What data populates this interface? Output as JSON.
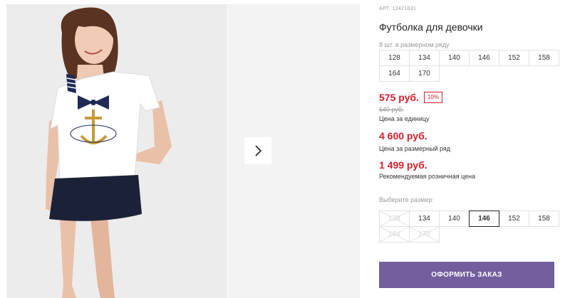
{
  "product": {
    "article_label": "АРТ.",
    "article_number": "12421631",
    "title": "Футболка для девочки"
  },
  "pack": {
    "label": "8 шт. в размерном ряду",
    "sizes": [
      "128",
      "134",
      "140",
      "146",
      "152",
      "158",
      "164",
      "170"
    ]
  },
  "prices": {
    "unit_price": "575 руб.",
    "discount": "10%",
    "old_price": "640 руб.",
    "unit_caption": "Цена за единицу",
    "set_price": "4 600 руб.",
    "set_caption": "Цена за размерный ряд",
    "rrp_price": "1 499 руб.",
    "rrp_caption": "Рекомендуемая розничная цена"
  },
  "size_picker": {
    "label": "Выберите размер:",
    "options": [
      {
        "size": "128",
        "state": "disabled"
      },
      {
        "size": "134",
        "state": "available"
      },
      {
        "size": "140",
        "state": "available"
      },
      {
        "size": "146",
        "state": "selected"
      },
      {
        "size": "152",
        "state": "available"
      },
      {
        "size": "158",
        "state": "available"
      },
      {
        "size": "164",
        "state": "disabled"
      },
      {
        "size": "170",
        "state": "disabled"
      }
    ]
  },
  "order_button": {
    "label": "ОФОРМИТЬ ЗАКАЗ"
  },
  "gallery": {
    "next_icon": "chevron-right-icon"
  },
  "colors": {
    "price_red": "#d0202a",
    "button_purple": "#735f9d",
    "tshirt_white": "#ffffff",
    "skirt_navy": "#1b2238",
    "stripe_navy": "#1f2a55"
  }
}
